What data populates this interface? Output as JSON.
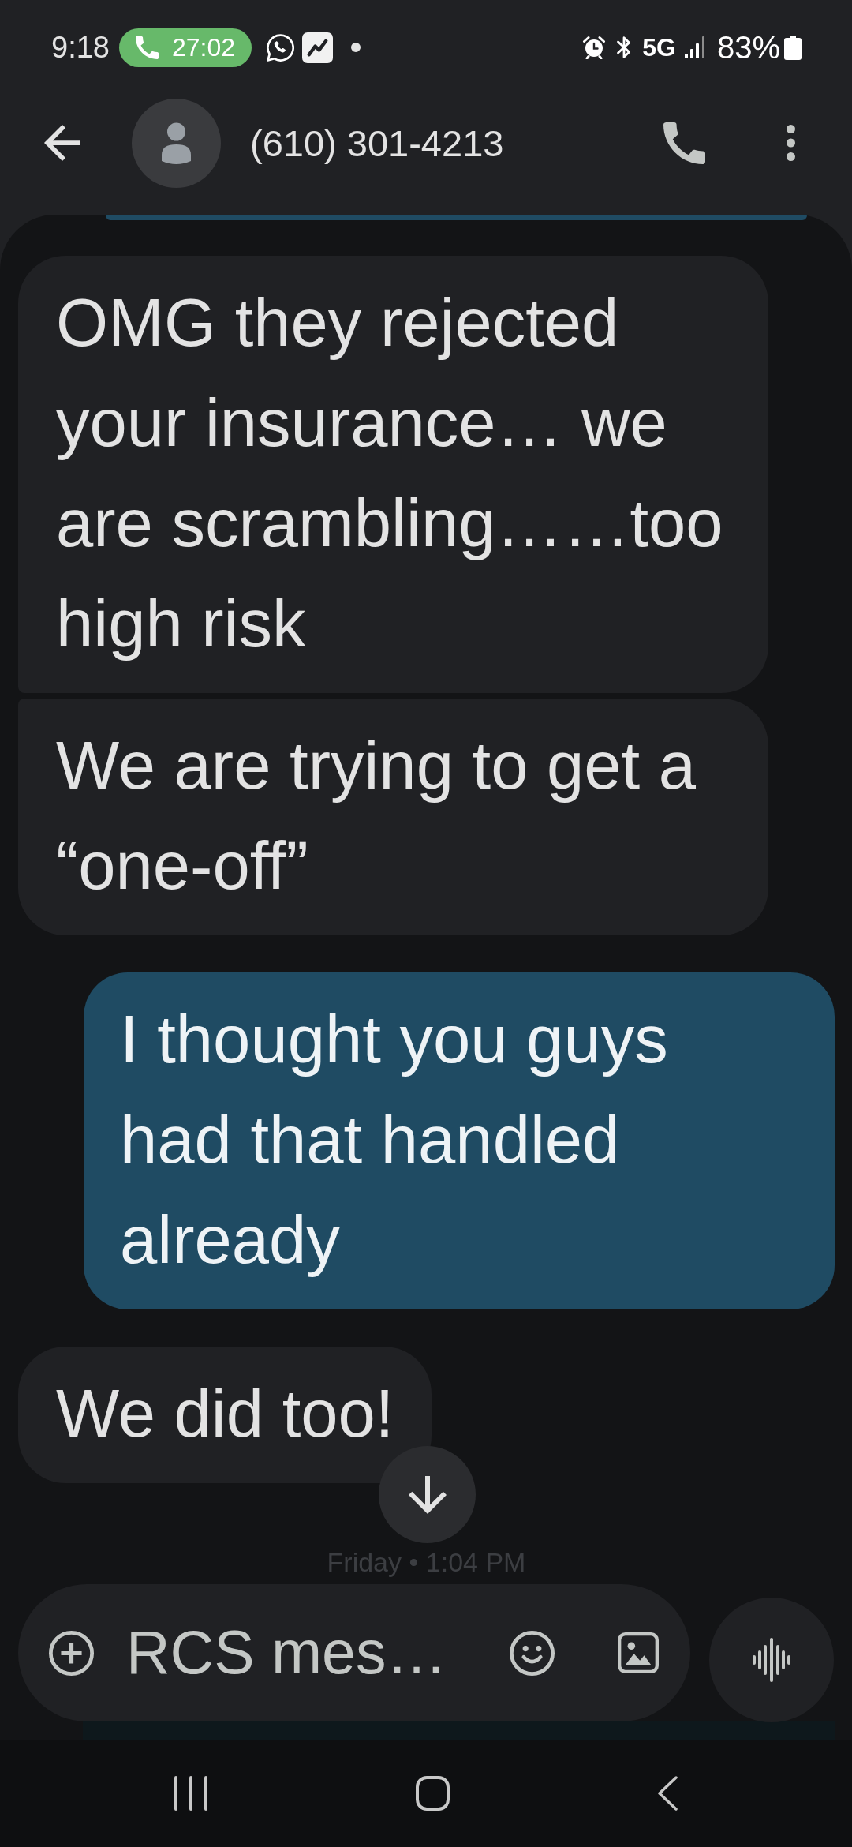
{
  "status_bar": {
    "time": "9:18",
    "call_duration": "27:02",
    "network": "5G",
    "battery": "83%"
  },
  "header": {
    "title": "(610) 301-4213"
  },
  "messages": [
    {
      "kind": "received",
      "text": "OMG they rejected your insurance… we are scrambling……too high risk"
    },
    {
      "kind": "received",
      "text": "We are trying to get a “one-off”"
    },
    {
      "kind": "sent",
      "text": "I thought you guys had that handled already"
    },
    {
      "kind": "received",
      "text": "We did too!"
    }
  ],
  "timestamp": "Friday • 1:04 PM",
  "compose": {
    "placeholder": "RCS mes…"
  }
}
